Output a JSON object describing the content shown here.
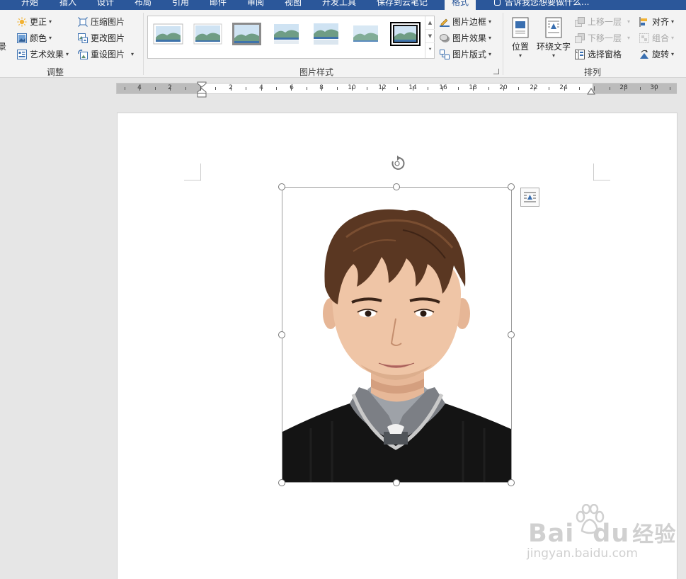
{
  "tabs": [
    {
      "label": "开始",
      "active": false
    },
    {
      "label": "插入",
      "active": false
    },
    {
      "label": "设计",
      "active": false
    },
    {
      "label": "布局",
      "active": false
    },
    {
      "label": "引用",
      "active": false
    },
    {
      "label": "邮件",
      "active": false
    },
    {
      "label": "审阅",
      "active": false
    },
    {
      "label": "视图",
      "active": false
    },
    {
      "label": "开发工具",
      "active": false
    },
    {
      "label": "保存到云笔记",
      "active": false
    },
    {
      "label": "格式",
      "active": true
    }
  ],
  "tell_me": {
    "placeholder": "告诉我您想要做什么...",
    "icon": "lightbulb-icon"
  },
  "ribbon": {
    "left_cut_label": "景",
    "adjust": {
      "group_label": "调整",
      "corrections": "更正",
      "color": "颜色",
      "artistic_effects": "艺术效果",
      "compress": "压缩图片",
      "change_picture": "更改图片",
      "reset_picture": "重设图片"
    },
    "picture_styles": {
      "group_label": "图片样式",
      "border": "图片边框",
      "effects": "图片效果",
      "layout": "图片版式",
      "selected_index": 6
    },
    "arrange": {
      "group_label": "排列",
      "position": "位置",
      "wrap_text": "环绕文字",
      "bring_forward": "上移一层",
      "send_backward": "下移一层",
      "selection_pane": "选择窗格",
      "align": "对齐",
      "group": "组合",
      "rotate": "旋转"
    }
  },
  "ruler": {
    "labels": [
      "4",
      "2",
      "2",
      "4",
      "6",
      "8",
      "10",
      "12",
      "14",
      "16",
      "18",
      "20",
      "22",
      "24",
      "28",
      "30"
    ]
  },
  "watermark": {
    "brand": "Bai",
    "brand2": "du",
    "brand_cn": "经验",
    "url": "jingyan.baidu.com"
  },
  "colors": {
    "tab_blue": "#2b579a",
    "ribbon_bg": "#f3f3f3",
    "page_bg": "#e6e6e6"
  }
}
